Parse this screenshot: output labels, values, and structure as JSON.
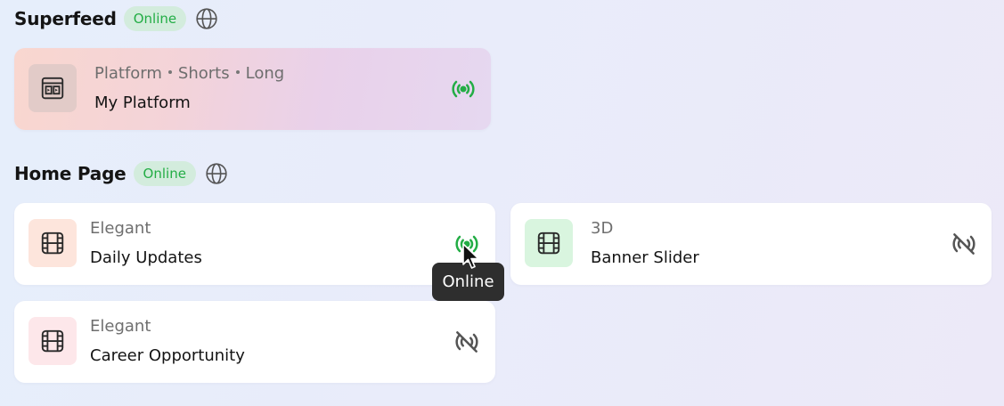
{
  "sections": [
    {
      "title": "Superfeed",
      "badge": "Online",
      "icon": "globe-icon",
      "items": [
        {
          "tags": [
            "Platform",
            "Shorts",
            "Long"
          ],
          "title": "My Platform",
          "thumb_icon": "platform-icon",
          "status": "online",
          "status_icon": "broadcast-icon"
        }
      ]
    },
    {
      "title": "Home Page",
      "badge": "Online",
      "icon": "globe-icon",
      "items": [
        {
          "subtitle": "Elegant",
          "title": "Daily Updates",
          "thumb_icon": "film-icon",
          "thumb_color": "#fde5dc",
          "status": "online",
          "status_icon": "broadcast-icon"
        },
        {
          "subtitle": "3D",
          "title": "Banner Slider",
          "thumb_icon": "film-icon",
          "thumb_color": "#d9f5df",
          "status": "offline",
          "status_icon": "broadcast-off-icon"
        },
        {
          "subtitle": "Elegant",
          "title": "Career Opportunity",
          "thumb_icon": "film-icon",
          "thumb_color": "#fde7ea",
          "status": "offline",
          "status_icon": "broadcast-off-icon"
        }
      ]
    }
  ],
  "tooltip": {
    "text": "Online"
  },
  "colors": {
    "online_green": "#23ad45",
    "badge_bg": "#d3ecdd",
    "offline_gray": "#555555",
    "tooltip_bg": "#2e2e2e"
  }
}
